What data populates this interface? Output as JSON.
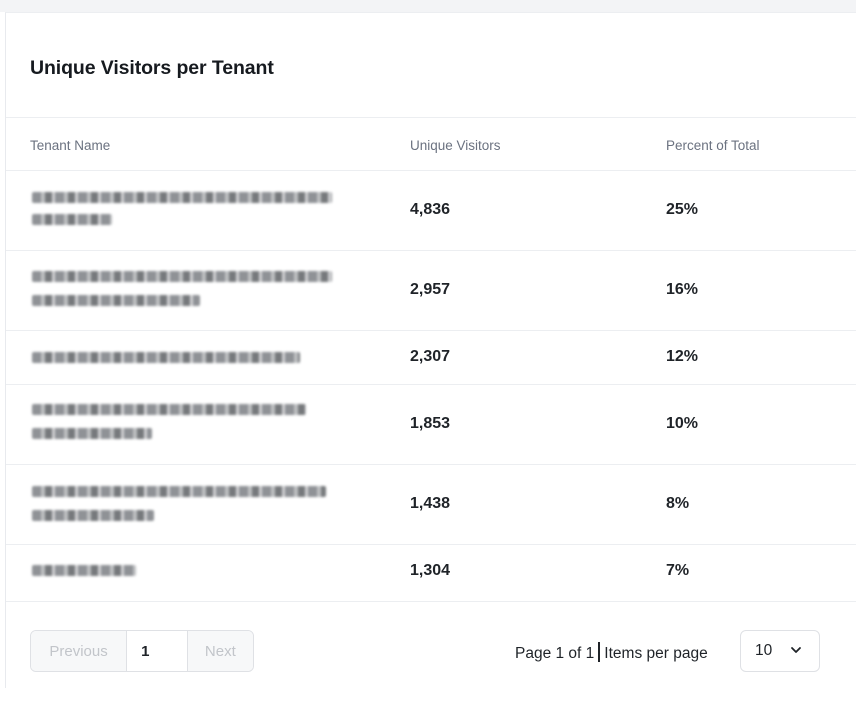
{
  "title": "Unique Visitors per Tenant",
  "table": {
    "headers": [
      "Tenant Name",
      "Unique Visitors",
      "Percent of Total"
    ],
    "rows": [
      {
        "tenant": "",
        "visitors": "4,836",
        "percent": "25%"
      },
      {
        "tenant": "",
        "visitors": "2,957",
        "percent": "16%"
      },
      {
        "tenant": "",
        "visitors": "2,307",
        "percent": "12%"
      },
      {
        "tenant": "",
        "visitors": "1,853",
        "percent": "10%"
      },
      {
        "tenant": "",
        "visitors": "1,438",
        "percent": "8%"
      },
      {
        "tenant": "",
        "visitors": "1,304",
        "percent": "7%"
      }
    ]
  },
  "pagination": {
    "previous_label": "Previous",
    "page_value": "1",
    "next_label": "Next",
    "page_info_left": "Page 1 of 1",
    "page_info_right": "Items per page",
    "items_per_page": "10"
  }
}
